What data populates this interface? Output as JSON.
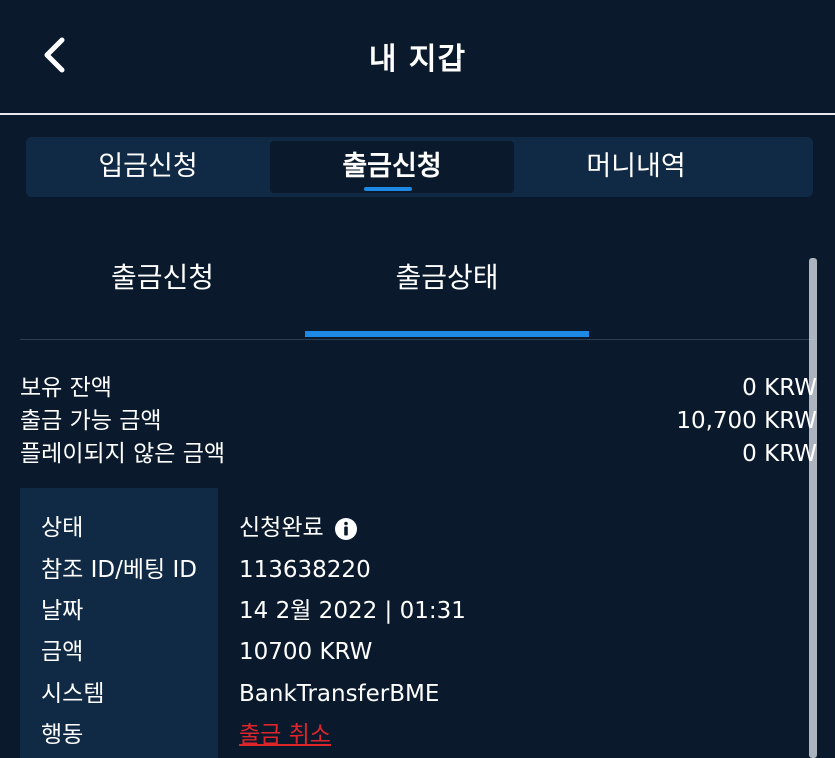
{
  "header": {
    "title": "내 지갑",
    "back_icon": "chevron-left-icon"
  },
  "main_tabs": [
    {
      "label": "입금신청",
      "active": false
    },
    {
      "label": "출금신청",
      "active": true
    },
    {
      "label": "머니내역",
      "active": false
    }
  ],
  "sub_tabs": [
    {
      "label": "출금신청",
      "active": false
    },
    {
      "label": "출금상태",
      "active": true
    }
  ],
  "balances": [
    {
      "label": "보유 잔액",
      "value": "0 KRW"
    },
    {
      "label": "출금 가능 금액",
      "value": "10,700 KRW"
    },
    {
      "label": "플레이되지 않은 금액",
      "value": "0 KRW"
    }
  ],
  "details": {
    "status_label": "상태",
    "status_value": "신청완료",
    "status_icon": "info-icon",
    "ref_label": "참조 ID/베팅 ID",
    "ref_value": "113638220",
    "date_label": "날짜",
    "date_value": "14 2월 2022 | 01:31",
    "amount_label": "금액",
    "amount_value": "10700 KRW",
    "system_label": "시스템",
    "system_value": "BankTransferBME",
    "action_label": "행동",
    "action_value": "출금 취소"
  },
  "colors": {
    "background": "#0a1a2c",
    "panel": "#102a45",
    "accent": "#1e88e5",
    "danger": "#e0242b"
  }
}
